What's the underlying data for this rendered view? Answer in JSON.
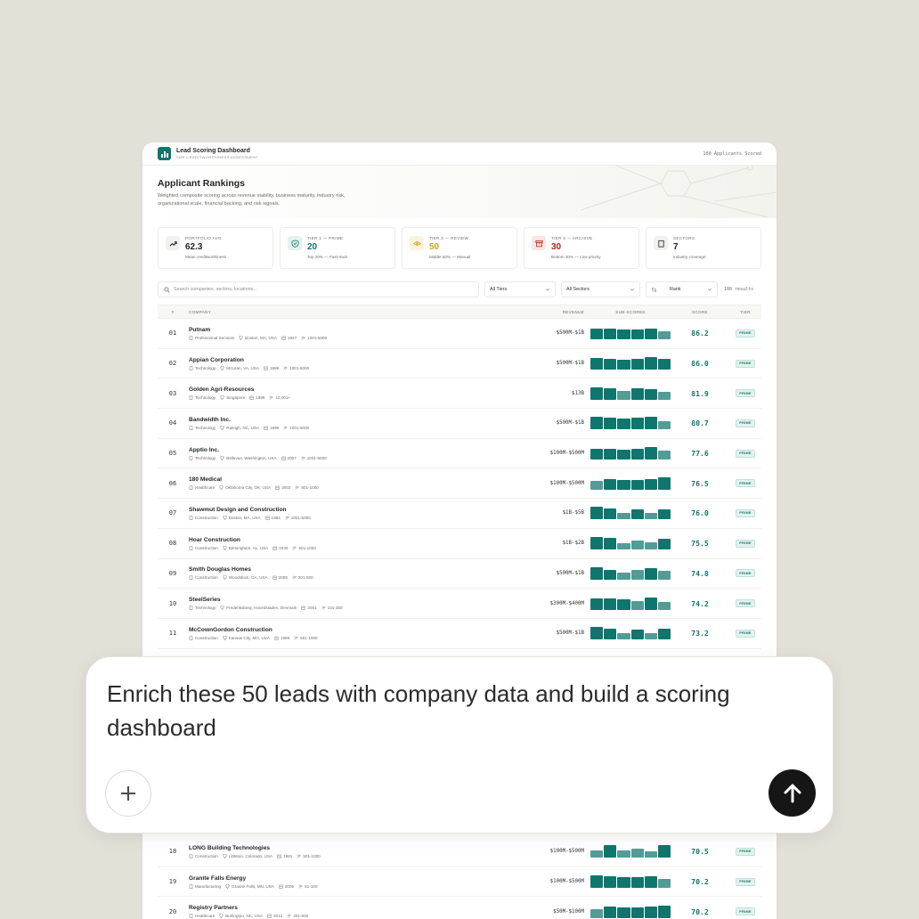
{
  "app": {
    "title": "Lead Scoring Dashboard",
    "subtitle": "SME CREDITWORTHINESS ASSESSMENT",
    "applicants_scored": "100 Applicants Scored"
  },
  "hero": {
    "title": "Applicant Rankings",
    "description": "Weighted composite scoring across revenue stability, business maturity, industry risk, organizational scale, financial backing, and risk signals."
  },
  "stats": [
    {
      "label": "PORTFOLIO AVG",
      "value": "62.3",
      "sub": "Mean creditworthiness",
      "color": "#1f2421",
      "icon": "trend-up-icon"
    },
    {
      "label": "TIER 1 — PRIME",
      "value": "20",
      "sub": "Top 20% — Fast-track",
      "color": "#0f766e",
      "icon": "shield-check-icon"
    },
    {
      "label": "TIER 2 — REVIEW",
      "value": "50",
      "sub": "Middle 50% — Manual",
      "color": "#d4a017",
      "icon": "eye-icon"
    },
    {
      "label": "TIER 3 — ARCHIVE",
      "value": "30",
      "sub": "Bottom 30% — Low priority",
      "color": "#b42318",
      "icon": "archive-icon"
    },
    {
      "label": "SECTORS",
      "value": "7",
      "sub": "Industry coverage",
      "color": "#1f2421",
      "icon": "building-icon"
    }
  ],
  "filters": {
    "search_placeholder": "Search companies, sectors, locations...",
    "tier_select": "All Tiers",
    "sector_select": "All Sectors",
    "sort_select": "Rank",
    "results": "100 results"
  },
  "table": {
    "headers": {
      "num": "#",
      "company": "COMPANY",
      "revenue": "REVENUE",
      "subscores": "SUB-SCORES",
      "score": "SCORE",
      "tier": "TIER"
    },
    "rows": [
      {
        "num": "01",
        "name": "Putnam",
        "sector": "Professional Services",
        "location": "Boston, MA, USA",
        "year": "1937",
        "employees": "1001-5000",
        "revenue": "$500M-$1B",
        "score": "86.2",
        "tier": "PRIME",
        "bars": [
          0.9,
          0.9,
          0.8,
          0.8,
          0.9,
          0.7
        ]
      },
      {
        "num": "02",
        "name": "Appian Corporation",
        "sector": "Technology",
        "location": "McLean, VA, USA",
        "year": "1999",
        "employees": "1001-5000",
        "revenue": "$500M-$1B",
        "score": "86.0",
        "tier": "PRIME",
        "bars": [
          0.9,
          0.85,
          0.8,
          0.85,
          1.0,
          0.85
        ]
      },
      {
        "num": "03",
        "name": "Golden Agri-Resources",
        "sector": "Technology",
        "location": "Singapore",
        "year": "1996",
        "employees": "10,001+",
        "revenue": "$13B",
        "score": "81.9",
        "tier": "PRIME",
        "bars": [
          1.0,
          0.9,
          0.7,
          0.9,
          0.85,
          0.6
        ]
      },
      {
        "num": "04",
        "name": "Bandwidth Inc.",
        "sector": "Technology",
        "location": "Raleigh, NC, USA",
        "year": "1999",
        "employees": "1001-5000",
        "revenue": "$500M-$1B",
        "score": "80.7",
        "tier": "PRIME",
        "bars": [
          1.0,
          0.95,
          0.9,
          0.95,
          1.0,
          0.7
        ]
      },
      {
        "num": "05",
        "name": "Apptio Inc.",
        "sector": "Technology",
        "location": "Bellevue, Washington, USA",
        "year": "2007",
        "employees": "1001-5000",
        "revenue": "$100M-$500M",
        "score": "77.6",
        "tier": "PRIME",
        "bars": [
          0.85,
          0.85,
          0.8,
          0.85,
          1.0,
          0.75
        ]
      },
      {
        "num": "06",
        "name": "180 Medical",
        "sector": "Healthcare",
        "location": "Oklahoma City, OK, USA",
        "year": "2002",
        "employees": "501-1000",
        "revenue": "$100M-$500M",
        "score": "76.5",
        "tier": "PRIME",
        "bars": [
          0.7,
          0.85,
          0.8,
          0.8,
          0.85,
          1.0
        ]
      },
      {
        "num": "07",
        "name": "Shawmut Design and Construction",
        "sector": "Construction",
        "location": "Boston, MA, USA",
        "year": "1982",
        "employees": "1001-5000",
        "revenue": "$1B-$5B",
        "score": "76.0",
        "tier": "PRIME",
        "bars": [
          1.0,
          0.9,
          0.5,
          0.85,
          0.55,
          0.8
        ]
      },
      {
        "num": "08",
        "name": "Hoar Construction",
        "sector": "Construction",
        "location": "Birmingham, AL, USA",
        "year": "1940",
        "employees": "501-1000",
        "revenue": "$1B-$2B",
        "score": "75.5",
        "tier": "PRIME",
        "bars": [
          1.0,
          0.95,
          0.5,
          0.7,
          0.55,
          0.85
        ]
      },
      {
        "num": "09",
        "name": "Smith Douglas Homes",
        "sector": "Construction",
        "location": "Woodstock, GA, USA",
        "year": "2009",
        "employees": "201-500",
        "revenue": "$500M-$1B",
        "score": "74.8",
        "tier": "PRIME",
        "bars": [
          1.0,
          0.8,
          0.55,
          0.75,
          0.95,
          0.7
        ]
      },
      {
        "num": "10",
        "name": "SteelSeries",
        "sector": "Technology",
        "location": "Frederiksberg, Hovedstaden, Denmark",
        "year": "2001",
        "employees": "101-250",
        "revenue": "$300M-$400M",
        "score": "74.2",
        "tier": "PRIME",
        "bars": [
          0.9,
          0.9,
          0.8,
          0.65,
          1.0,
          0.6
        ]
      },
      {
        "num": "11",
        "name": "McCownGordon Construction",
        "sector": "Construction",
        "location": "Kansas City, MO, USA",
        "year": "1999",
        "employees": "501-1000",
        "revenue": "$500M-$1B",
        "score": "73.2",
        "tier": "PRIME",
        "bars": [
          1.0,
          0.9,
          0.55,
          0.8,
          0.55,
          0.85
        ]
      }
    ],
    "rows_bottom": [
      {
        "num": "18",
        "name": "LONG Building Technologies",
        "sector": "Construction",
        "location": "Littleton, Colorado, USA",
        "year": "1961",
        "employees": "501-1000",
        "revenue": "$100M-$500M",
        "score": "70.5",
        "tier": "PRIME",
        "bars": [
          0.6,
          1.0,
          0.6,
          0.75,
          0.55,
          1.0
        ]
      },
      {
        "num": "19",
        "name": "Granite Falls Energy",
        "sector": "Manufacturing",
        "location": "Granite Falls, MN, USA",
        "year": "2005",
        "employees": "51-100",
        "revenue": "$100M-$500M",
        "score": "70.2",
        "tier": "PRIME",
        "bars": [
          1.0,
          0.9,
          0.85,
          0.85,
          0.9,
          0.7
        ]
      },
      {
        "num": "20",
        "name": "Registry Partners",
        "sector": "Healthcare",
        "location": "Burlington, NC, USA",
        "year": "2012",
        "employees": "201-500",
        "revenue": "$50M-$100M",
        "score": "70.2",
        "tier": "PRIME",
        "bars": [
          0.7,
          0.9,
          0.85,
          0.85,
          0.9,
          1.0
        ]
      }
    ]
  },
  "prompt": {
    "text": "Enrich these 50 leads with company data and build a scoring dashboard"
  }
}
